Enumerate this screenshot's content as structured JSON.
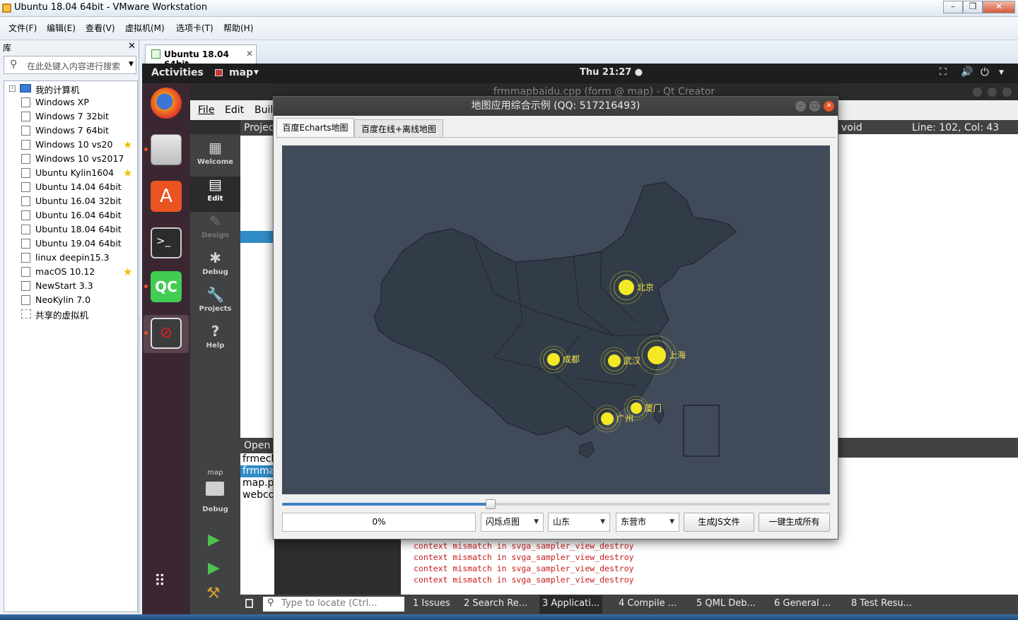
{
  "vmware": {
    "title": "Ubuntu 18.04 64bit - VMware Workstation",
    "menu": [
      "文件(F)",
      "编辑(E)",
      "查看(V)",
      "虚拟机(M)",
      "选项卡(T)",
      "帮助(H)"
    ],
    "library_label": "库",
    "search_placeholder": "在此处键入内容进行搜索",
    "tree_root": "我的计算机",
    "vms": [
      {
        "name": "Windows XP",
        "starred": false
      },
      {
        "name": "Windows 7 32bit",
        "starred": false
      },
      {
        "name": "Windows 7 64bit",
        "starred": false
      },
      {
        "name": "Windows 10 vs20",
        "starred": true
      },
      {
        "name": "Windows 10 vs2017",
        "starred": false
      },
      {
        "name": "Ubuntu Kylin1604",
        "starred": true
      },
      {
        "name": "Ubuntu 14.04 64bit",
        "starred": false
      },
      {
        "name": "Ubuntu 16.04 32bit",
        "starred": false
      },
      {
        "name": "Ubuntu 16.04 64bit",
        "starred": false
      },
      {
        "name": "Ubuntu 18.04 64bit",
        "starred": false
      },
      {
        "name": "Ubuntu 19.04 64bit",
        "starred": false
      },
      {
        "name": "linux deepin15.3",
        "starred": false
      },
      {
        "name": "macOS 10.12",
        "starred": true
      },
      {
        "name": "NewStart 3.3",
        "starred": false
      },
      {
        "name": "NeoKylin 7.0",
        "starred": false
      }
    ],
    "shared": "共享的虚拟机",
    "active_tab": "Ubuntu 18.04 64bit"
  },
  "ubuntu": {
    "activities": "Activities",
    "app": "map",
    "clock": "Thu 21:27 ●"
  },
  "qt": {
    "window_title": "frmmapbaidu.cpp (form @ map) - Qt Creator",
    "menu": [
      "File",
      "Edit",
      "Buil"
    ],
    "projects_label": "Projec",
    "modes": [
      {
        "icon": "▦",
        "label": "Welcome"
      },
      {
        "icon": "▤",
        "label": "Edit"
      },
      {
        "icon": "✎",
        "label": "Design"
      },
      {
        "icon": "✱",
        "label": "Debug"
      },
      {
        "icon": "🔧",
        "label": "Projects"
      },
      {
        "icon": "?",
        "label": "Help"
      }
    ],
    "kit_project": "map",
    "kit_mode": "Debug",
    "open_docs_label": "Open",
    "open_docs": [
      "frmecl",
      "frmma",
      "map.p",
      "webco"
    ],
    "func_combo": "void",
    "line_col": "Line: 102, Col: 43",
    "errors": [
      "context mismatch in svga_sampler_view_destroy",
      "context mismatch in svga_sampler_view_destroy",
      "context mismatch in svga_sampler_view_destroy",
      "context mismatch in svga_sampler_view_destroy"
    ],
    "locator_placeholder": "Type to locate (Ctrl...",
    "panes": [
      "1  Issues",
      "2  Search Re...",
      "3  Applicati...",
      "4  Compile ...",
      "5  QML Deb...",
      "6  General ...",
      "8  Test Resu..."
    ]
  },
  "dialog": {
    "title": "地图应用综合示例 (QQ: 517216493)",
    "tabs": [
      "百度Echarts地图",
      "百度在线+离线地图"
    ],
    "cities": [
      "北京",
      "上海",
      "武汉",
      "成都",
      "厦门",
      "广州"
    ],
    "progress": 0,
    "progress_text": "0%",
    "slider_value": 0.38,
    "map_type": "闪烁点图",
    "province": "山东",
    "city": "东营市",
    "btn_gen_js": "生成JS文件",
    "btn_gen_all": "一键生成所有",
    "colors": {
      "map_bg": "#404a59",
      "land": "#323c48",
      "border": "#1e2631",
      "point": "#f4e925"
    }
  }
}
